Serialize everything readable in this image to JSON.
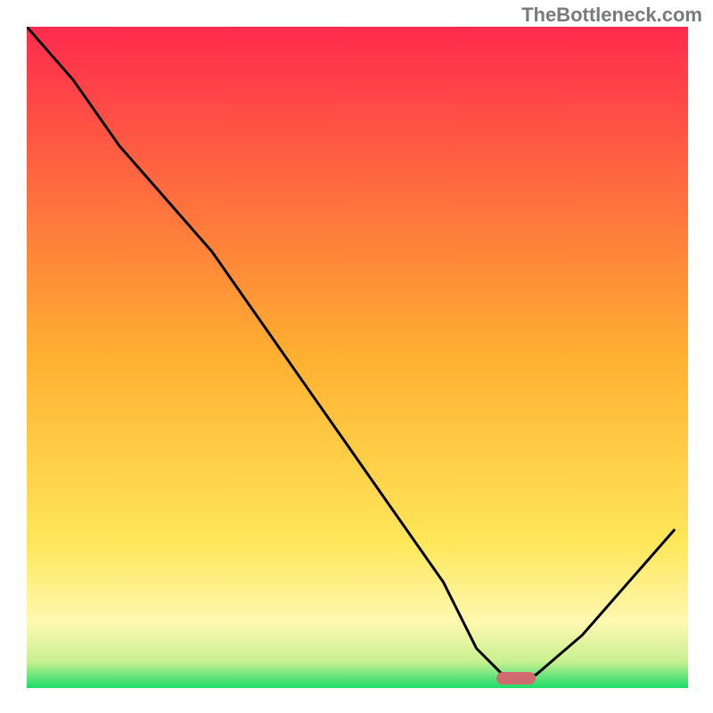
{
  "watermark": "TheBottleneck.com",
  "chart_data": {
    "type": "line",
    "x": [
      0.0,
      0.07,
      0.14,
      0.21,
      0.28,
      0.35,
      0.42,
      0.49,
      0.56,
      0.63,
      0.68,
      0.72,
      0.77,
      0.84,
      0.91,
      0.98
    ],
    "values": [
      1.0,
      0.92,
      0.82,
      0.74,
      0.66,
      0.56,
      0.46,
      0.36,
      0.26,
      0.16,
      0.06,
      0.02,
      0.02,
      0.08,
      0.16,
      0.24
    ],
    "title": "",
    "xlabel": "",
    "ylabel": "",
    "xlim": [
      0,
      1
    ],
    "ylim": [
      0,
      1
    ],
    "background": {
      "type": "vertical-gradient",
      "stops": [
        {
          "pos": 0.0,
          "color": "#ff2a4d"
        },
        {
          "pos": 0.5,
          "color": "#ffb030"
        },
        {
          "pos": 0.78,
          "color": "#ffe75a"
        },
        {
          "pos": 0.9,
          "color": "#fff8b0"
        },
        {
          "pos": 0.96,
          "color": "#c8f090"
        },
        {
          "pos": 1.0,
          "color": "#1ddb6b"
        }
      ]
    },
    "marker": {
      "x": 0.74,
      "y": 0.015,
      "color": "#cf6a6f"
    }
  }
}
